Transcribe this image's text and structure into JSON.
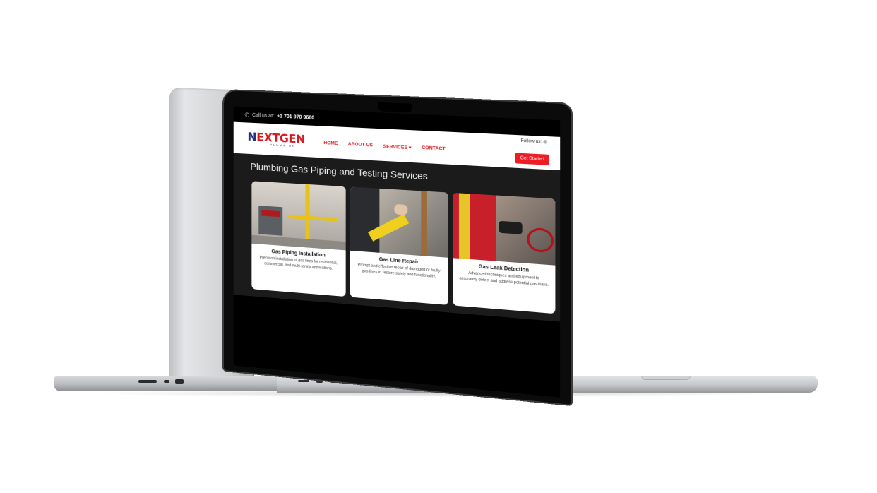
{
  "topbar": {
    "call_label": "Call us at:",
    "phone": "+1 701 970 9660"
  },
  "brand": {
    "logo_main_n": "N",
    "logo_main_rest": "EXTGEN",
    "logo_sub": "PLUMBING"
  },
  "nav": {
    "items": [
      {
        "label": "HOME"
      },
      {
        "label": "ABOUT US"
      },
      {
        "label": "SERVICES ▾"
      },
      {
        "label": "CONTACT"
      }
    ],
    "follow_label": "Follow us:",
    "cta_label": "Get Started"
  },
  "hero": {
    "title": "Plumbing Gas Piping and Testing Services",
    "cards": [
      {
        "title": "Gas Piping Installation",
        "text": "Precision installation of gas lines for residential, commercial, and multi-family applications."
      },
      {
        "title": "Gas Line Repair",
        "text": "Prompt and effective repair of damaged or faulty gas lines to restore safety and functionality."
      },
      {
        "title": "Gas Leak Detection",
        "text": "Advanced techniques and equipment to accurately detect and address potential gas leaks."
      }
    ]
  },
  "colors": {
    "accent": "#ee1c24",
    "navy": "#1f2f7a",
    "hero_bg": "#1b1b1c"
  },
  "icons": {
    "phone": "phone-icon",
    "instagram": "instagram-icon"
  }
}
